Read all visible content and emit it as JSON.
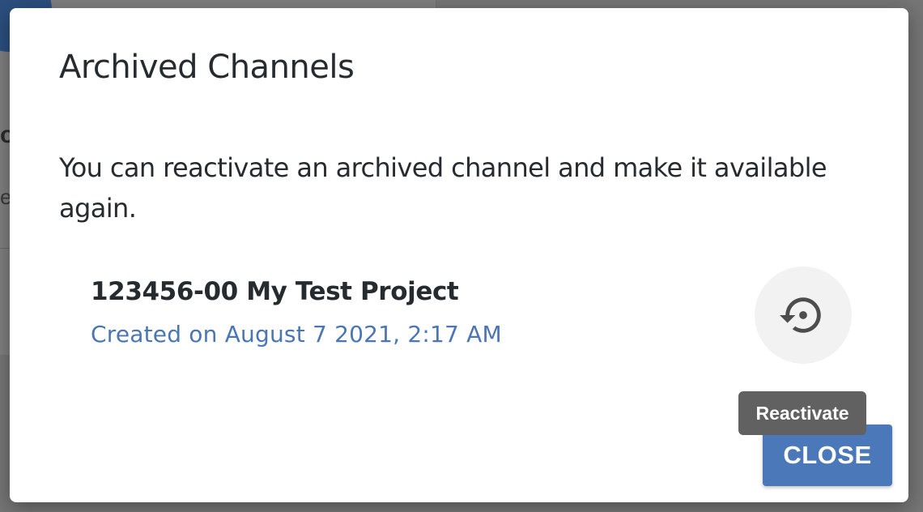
{
  "dialog": {
    "title": "Archived Channels",
    "description": "You can reactivate an archived channel and make it available again.",
    "channels": [
      {
        "name": "123456-00 My Test Project",
        "created": "Created on August 7 2021, 2:17 AM",
        "action_icon": "restore-icon"
      }
    ],
    "tooltip": "Reactivate",
    "close_label": "CLOSE"
  },
  "colors": {
    "primary": "#4a78b8",
    "link_text": "#4a76b3",
    "tooltip_bg": "#616161",
    "icon_button_bg": "#f2f2f2",
    "backdrop": "#757575"
  }
}
